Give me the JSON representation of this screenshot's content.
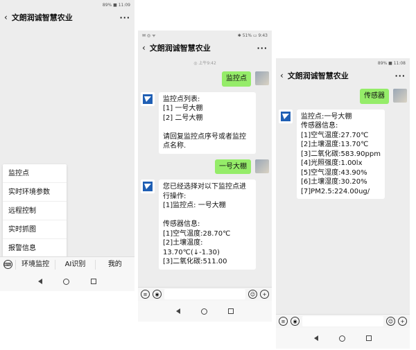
{
  "chat_title": "文朗润诚智慧农业",
  "p1": {
    "status_left": "",
    "status_right": "89% ■ 11:09",
    "popup": [
      "监控点",
      "实时环境参数",
      "远程控制",
      "实时抓图",
      "报警信息"
    ],
    "menu": [
      "环境监控",
      "AI识别",
      "我的"
    ]
  },
  "p2": {
    "status_left": "✉ ◎ ᯤ",
    "status_right": "✱ 51% ▭ 9:43",
    "time": "◎ 上午9:42",
    "messages": [
      {
        "from": "me",
        "text": "监控点"
      },
      {
        "from": "bot",
        "text": "监控点列表:\n[1] 一号大棚\n[2] 二号大棚\n\n请回复监控点序号或者监控点名称."
      },
      {
        "from": "me",
        "text": "一号大棚"
      },
      {
        "from": "bot",
        "text": "您已经选择对以下监控点进行操作:\n[1]监控点: 一号大棚\n\n传感器信息:\n[1]空气温度:28.70℃\n[2]土壤温度:\n13.70℃(↓-1.30)\n[3]二氧化碳:511.00"
      }
    ]
  },
  "p3": {
    "status_left": "",
    "status_right": "89% ■ 11:08",
    "messages": [
      {
        "from": "me",
        "text": "传感器"
      },
      {
        "from": "bot",
        "text": "监控点:一号大棚\n传感器信息:\n[1]空气温度:27.70℃\n[2]土壤温度:13.70℃\n[3]二氧化碳:583.90ppm\n[4]光照强度:1.00lx\n[5]空气湿度:43.90%\n[6]土壤湿度:30.20%\n[7]PM2.5:224.00ug/"
      }
    ]
  },
  "colors": {
    "out_bubble": "#95ec69",
    "in_bubble": "#ffffff",
    "bg": "#ededed"
  }
}
